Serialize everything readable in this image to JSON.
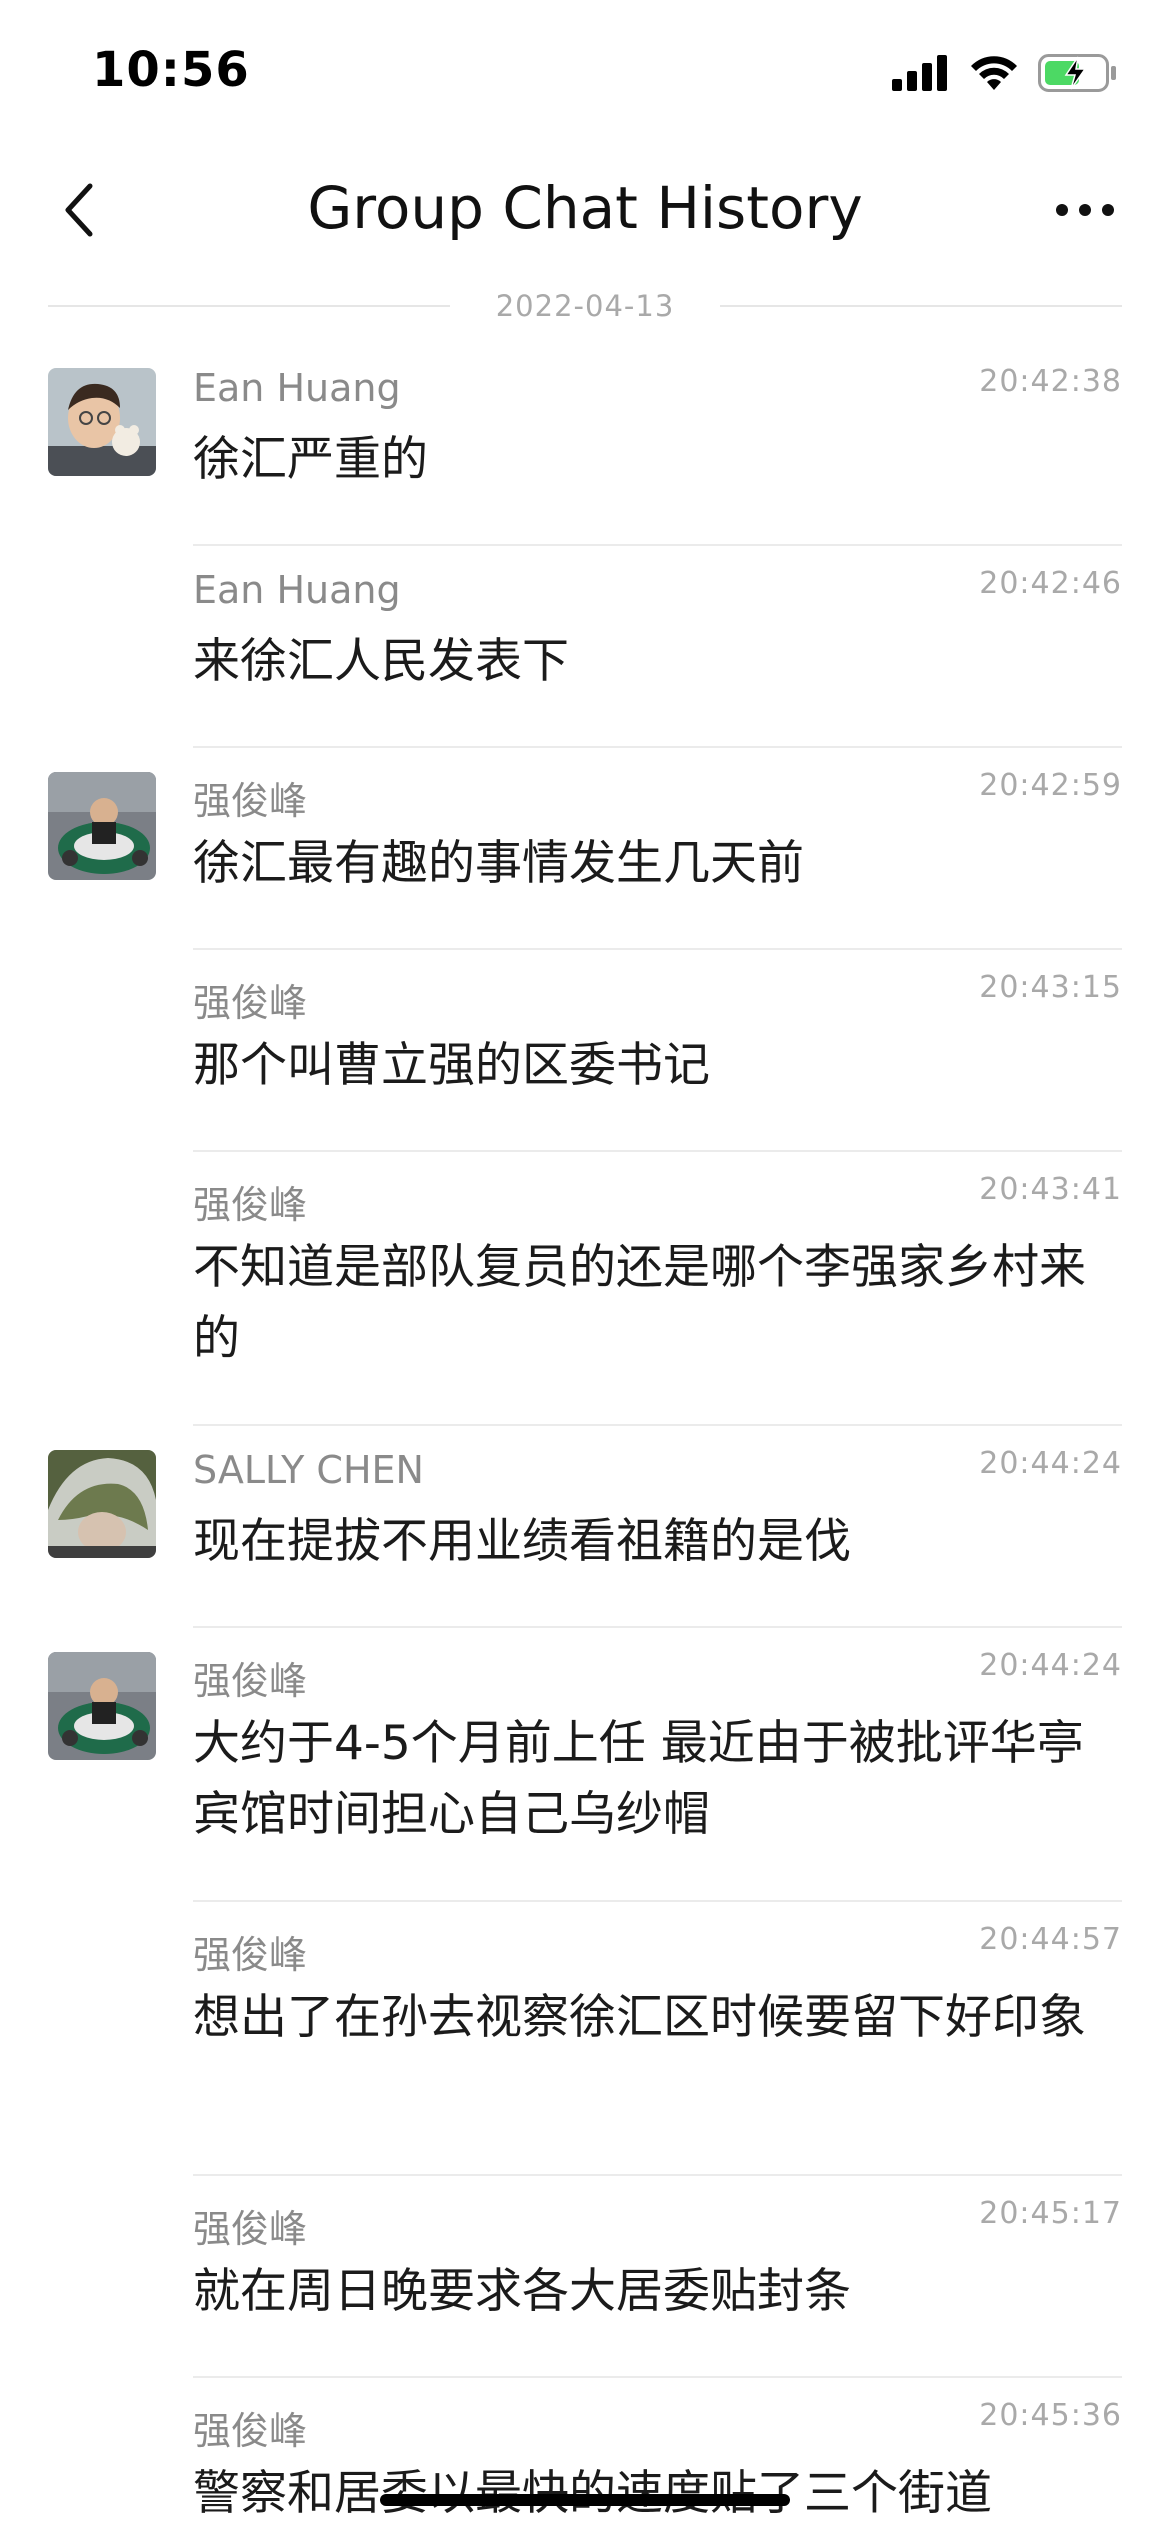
{
  "status_bar": {
    "time": "10:56",
    "battery_color": "#4cd964"
  },
  "nav": {
    "title": "Group Chat History"
  },
  "date_divider": "2022-04-13",
  "messages": [
    {
      "sender": "Ean Huang",
      "time": "20:42:38",
      "text": "徐汇严重的",
      "avatar": "boy-with-stuffed-toy",
      "show_avatar": true
    },
    {
      "sender": "Ean Huang",
      "time": "20:42:46",
      "text": "来徐汇人民发表下",
      "avatar": "",
      "show_avatar": false
    },
    {
      "sender": "强俊峰",
      "time": "20:42:59",
      "text": "徐汇最有趣的事情发生几天前",
      "avatar": "child-in-toy-car",
      "show_avatar": true
    },
    {
      "sender": "强俊峰",
      "time": "20:43:15",
      "text": "那个叫曹立强的区委书记",
      "avatar": "",
      "show_avatar": false
    },
    {
      "sender": "强俊峰",
      "time": "20:43:41",
      "text": "不知道是部队复员的还是哪个李强家乡村来的",
      "avatar": "",
      "show_avatar": false
    },
    {
      "sender": "SALLY CHEN",
      "time": "20:44:24",
      "text": "现在提拔不用业绩看祖籍的是伐",
      "avatar": "woman-green-hat",
      "show_avatar": true
    },
    {
      "sender": "强俊峰",
      "time": "20:44:24",
      "text": "大约于4-5个月前上任 最近由于被批评华亭宾馆时间担心自己乌纱帽",
      "avatar": "child-in-toy-car",
      "show_avatar": true
    },
    {
      "sender": "强俊峰",
      "time": "20:44:57",
      "text": "想出了在孙去视察徐汇区时候要留下好印象",
      "avatar": "",
      "show_avatar": false
    },
    {
      "sender": "强俊峰",
      "time": "20:45:17",
      "text": "就在周日晚要求各大居委贴封条",
      "avatar": "",
      "show_avatar": false
    },
    {
      "sender": "强俊峰",
      "time": "20:45:36",
      "text": "警察和居委以最快的速度贴了三个街道",
      "avatar": "",
      "show_avatar": false
    }
  ]
}
